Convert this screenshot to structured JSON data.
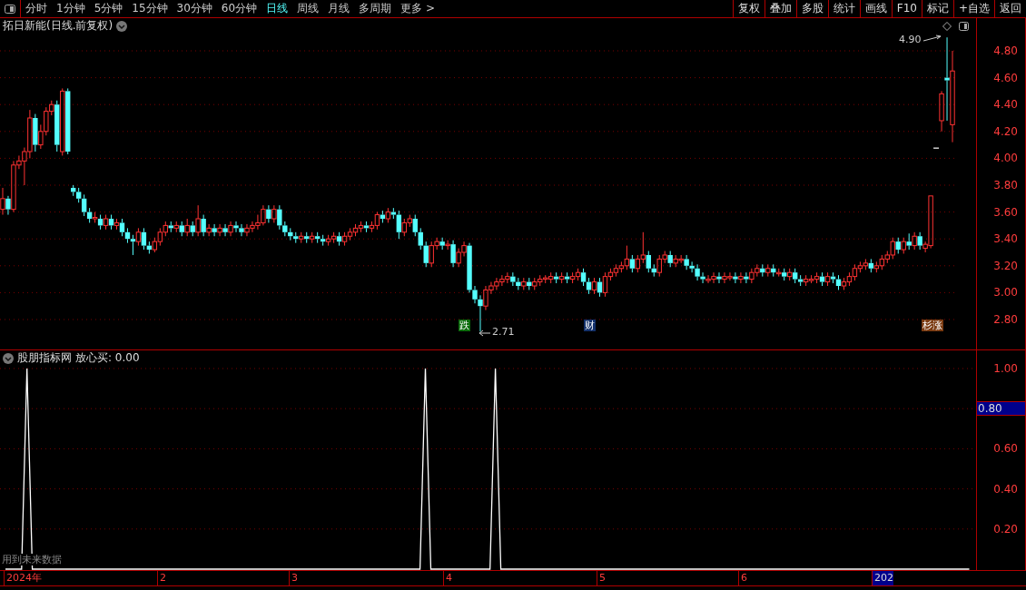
{
  "toolbar": {
    "tabs": [
      {
        "label": "分时",
        "selected": false
      },
      {
        "label": "1分钟",
        "selected": false
      },
      {
        "label": "5分钟",
        "selected": false
      },
      {
        "label": "15分钟",
        "selected": false
      },
      {
        "label": "30分钟",
        "selected": false
      },
      {
        "label": "60分钟",
        "selected": false
      },
      {
        "label": "日线",
        "selected": true
      },
      {
        "label": "周线",
        "selected": false
      },
      {
        "label": "月线",
        "selected": false
      },
      {
        "label": "多周期",
        "selected": false
      },
      {
        "label": "更多 >",
        "selected": false
      }
    ],
    "buttons": [
      "复权",
      "叠加",
      "多股",
      "统计",
      "画线",
      "F10",
      "标记",
      "+自选",
      "返回"
    ]
  },
  "price_chart": {
    "title": "拓日新能(日线.前复权)",
    "annotations": [
      {
        "text": "4.90"
      },
      {
        "text": "2.71"
      }
    ],
    "markers": [
      {
        "text": "跌",
        "color": "#0a6a0a"
      },
      {
        "text": "财",
        "color": "#12306a"
      },
      {
        "text": "杉涨",
        "color": "#7a3a10"
      }
    ],
    "chart_data": {
      "type": "candlestick",
      "ylim": [
        2.8,
        4.8
      ],
      "grid": true,
      "categories": [
        null,
        null,
        null,
        null,
        null,
        null,
        null,
        null,
        null,
        null,
        null,
        null,
        null,
        null,
        null,
        null,
        null,
        null,
        null,
        null,
        null,
        null,
        null,
        null,
        null,
        null,
        null,
        null,
        null,
        null,
        null,
        null,
        null,
        null,
        null,
        null,
        null,
        null,
        null,
        null,
        null,
        null,
        null,
        null,
        null,
        null,
        null,
        null,
        null,
        null,
        null,
        null,
        null,
        null,
        null,
        null,
        null,
        null,
        null,
        null,
        null,
        null,
        null,
        null,
        null,
        null,
        null,
        null,
        null,
        null,
        null,
        null,
        null,
        null,
        null,
        null,
        null,
        null,
        null,
        null,
        null,
        null,
        null,
        null,
        null,
        null,
        null,
        null,
        null,
        null,
        null,
        null,
        null,
        null,
        null,
        null,
        null,
        null,
        null,
        null,
        null,
        null,
        null,
        null,
        null,
        null,
        null,
        null,
        null,
        null,
        null,
        null,
        null,
        null,
        null,
        null,
        null,
        null,
        null,
        null,
        null,
        null,
        null,
        null,
        null,
        null,
        null,
        null,
        null,
        null,
        null,
        null,
        null,
        null,
        null,
        null,
        null,
        null,
        null,
        null,
        null,
        null,
        null,
        null,
        null,
        null,
        null,
        null,
        null,
        null,
        null,
        null,
        null,
        null,
        null,
        null,
        null,
        null,
        null,
        null,
        null,
        null,
        null,
        null,
        null,
        null,
        null,
        null,
        null,
        null,
        null,
        null,
        null,
        null,
        null,
        null
      ],
      "yticks": [
        {
          "value": 4.8,
          "label": "4.80"
        },
        {
          "value": 4.6,
          "label": "4.60"
        },
        {
          "value": 4.4,
          "label": "4.40"
        },
        {
          "value": 4.2,
          "label": "4.20"
        },
        {
          "value": 4.0,
          "label": "4.00"
        },
        {
          "value": 3.8,
          "label": "3.80"
        },
        {
          "value": 3.6,
          "label": "3.60"
        },
        {
          "value": 3.4,
          "label": "3.40"
        },
        {
          "value": 3.2,
          "label": "3.20"
        },
        {
          "value": 3.0,
          "label": "3.00"
        },
        {
          "value": 2.8,
          "label": "2.80"
        }
      ],
      "ohlc": [
        [
          3.62,
          3.78,
          3.58,
          3.7
        ],
        [
          3.7,
          3.72,
          3.58,
          3.62
        ],
        [
          3.62,
          3.98,
          3.6,
          3.95
        ],
        [
          3.95,
          4.02,
          3.92,
          3.98
        ],
        [
          3.98,
          4.08,
          3.8,
          4.05
        ],
        [
          4.05,
          4.36,
          4.0,
          4.3
        ],
        [
          4.3,
          4.33,
          4.05,
          4.1
        ],
        [
          4.1,
          4.25,
          4.07,
          4.2
        ],
        [
          4.2,
          4.38,
          4.17,
          4.35
        ],
        [
          4.35,
          4.43,
          4.32,
          4.4
        ],
        [
          4.4,
          4.43,
          4.05,
          4.1
        ],
        [
          4.05,
          4.52,
          4.02,
          4.5
        ],
        [
          4.5,
          4.52,
          4.03,
          4.05
        ],
        [
          3.78,
          3.8,
          3.72,
          3.75
        ],
        [
          3.75,
          3.78,
          3.67,
          3.7
        ],
        [
          3.7,
          3.73,
          3.57,
          3.6
        ],
        [
          3.6,
          3.63,
          3.52,
          3.55
        ],
        [
          3.55,
          3.6,
          3.52,
          3.56
        ],
        [
          3.55,
          3.58,
          3.47,
          3.5
        ],
        [
          3.5,
          3.58,
          3.47,
          3.55
        ],
        [
          3.55,
          3.58,
          3.47,
          3.5
        ],
        [
          3.5,
          3.55,
          3.47,
          3.52
        ],
        [
          3.52,
          3.55,
          3.42,
          3.45
        ],
        [
          3.45,
          3.48,
          3.37,
          3.4
        ],
        [
          3.4,
          3.43,
          3.28,
          3.38
        ],
        [
          3.38,
          3.48,
          3.35,
          3.45
        ],
        [
          3.45,
          3.48,
          3.32,
          3.35
        ],
        [
          3.35,
          3.38,
          3.29,
          3.32
        ],
        [
          3.32,
          3.41,
          3.3,
          3.38
        ],
        [
          3.38,
          3.48,
          3.35,
          3.45
        ],
        [
          3.45,
          3.53,
          3.42,
          3.5
        ],
        [
          3.5,
          3.53,
          3.45,
          3.48
        ],
        [
          3.48,
          3.53,
          3.45,
          3.5
        ],
        [
          3.5,
          3.53,
          3.42,
          3.45
        ],
        [
          3.45,
          3.55,
          3.42,
          3.5
        ],
        [
          3.5,
          3.53,
          3.42,
          3.45
        ],
        [
          3.45,
          3.65,
          3.42,
          3.55
        ],
        [
          3.55,
          3.58,
          3.42,
          3.45
        ],
        [
          3.45,
          3.51,
          3.42,
          3.48
        ],
        [
          3.48,
          3.51,
          3.42,
          3.45
        ],
        [
          3.45,
          3.51,
          3.42,
          3.48
        ],
        [
          3.48,
          3.51,
          3.42,
          3.45
        ],
        [
          3.45,
          3.53,
          3.42,
          3.5
        ],
        [
          3.5,
          3.53,
          3.45,
          3.48
        ],
        [
          3.48,
          3.51,
          3.42,
          3.45
        ],
        [
          3.45,
          3.51,
          3.42,
          3.48
        ],
        [
          3.48,
          3.53,
          3.45,
          3.5
        ],
        [
          3.5,
          3.58,
          3.47,
          3.52
        ],
        [
          3.52,
          3.65,
          3.5,
          3.62
        ],
        [
          3.62,
          3.65,
          3.52,
          3.55
        ],
        [
          3.55,
          3.65,
          3.52,
          3.62
        ],
        [
          3.62,
          3.65,
          3.47,
          3.5
        ],
        [
          3.5,
          3.53,
          3.42,
          3.45
        ],
        [
          3.45,
          3.48,
          3.39,
          3.42
        ],
        [
          3.42,
          3.45,
          3.37,
          3.4
        ],
        [
          3.4,
          3.45,
          3.37,
          3.42
        ],
        [
          3.42,
          3.45,
          3.37,
          3.4
        ],
        [
          3.4,
          3.45,
          3.37,
          3.42
        ],
        [
          3.42,
          3.45,
          3.37,
          3.4
        ],
        [
          3.4,
          3.43,
          3.35,
          3.38
        ],
        [
          3.38,
          3.43,
          3.35,
          3.4
        ],
        [
          3.4,
          3.45,
          3.37,
          3.42
        ],
        [
          3.42,
          3.45,
          3.35,
          3.38
        ],
        [
          3.38,
          3.45,
          3.35,
          3.42
        ],
        [
          3.42,
          3.48,
          3.39,
          3.45
        ],
        [
          3.45,
          3.51,
          3.42,
          3.48
        ],
        [
          3.48,
          3.53,
          3.45,
          3.5
        ],
        [
          3.5,
          3.53,
          3.45,
          3.48
        ],
        [
          3.48,
          3.53,
          3.45,
          3.5
        ],
        [
          3.5,
          3.6,
          3.47,
          3.58
        ],
        [
          3.58,
          3.61,
          3.52,
          3.55
        ],
        [
          3.55,
          3.63,
          3.52,
          3.6
        ],
        [
          3.6,
          3.63,
          3.55,
          3.58
        ],
        [
          3.58,
          3.61,
          3.4,
          3.45
        ],
        [
          3.45,
          3.55,
          3.42,
          3.52
        ],
        [
          3.52,
          3.58,
          3.49,
          3.55
        ],
        [
          3.55,
          3.58,
          3.42,
          3.45
        ],
        [
          3.45,
          3.48,
          3.32,
          3.35
        ],
        [
          3.35,
          3.38,
          3.19,
          3.22
        ],
        [
          3.22,
          3.38,
          3.19,
          3.35
        ],
        [
          3.35,
          3.41,
          3.32,
          3.38
        ],
        [
          3.38,
          3.41,
          3.32,
          3.35
        ],
        [
          3.35,
          3.39,
          3.32,
          3.36
        ],
        [
          3.36,
          3.39,
          3.19,
          3.22
        ],
        [
          3.22,
          3.33,
          3.19,
          3.3
        ],
        [
          3.3,
          3.38,
          3.27,
          3.35
        ],
        [
          3.35,
          3.37,
          3.0,
          3.02
        ],
        [
          3.02,
          3.05,
          2.92,
          2.95
        ],
        [
          2.95,
          2.98,
          2.71,
          2.9
        ],
        [
          2.9,
          3.05,
          2.87,
          3.02
        ],
        [
          3.02,
          3.08,
          2.99,
          3.05
        ],
        [
          3.05,
          3.11,
          3.02,
          3.08
        ],
        [
          3.08,
          3.13,
          3.05,
          3.1
        ],
        [
          3.1,
          3.15,
          3.07,
          3.12
        ],
        [
          3.12,
          3.15,
          3.05,
          3.08
        ],
        [
          3.08,
          3.11,
          3.02,
          3.05
        ],
        [
          3.05,
          3.11,
          3.02,
          3.08
        ],
        [
          3.08,
          3.11,
          3.02,
          3.05
        ],
        [
          3.05,
          3.11,
          3.02,
          3.08
        ],
        [
          3.08,
          3.13,
          3.05,
          3.1
        ],
        [
          3.1,
          3.13,
          3.07,
          3.11
        ],
        [
          3.1,
          3.15,
          3.07,
          3.12
        ],
        [
          3.12,
          3.15,
          3.07,
          3.1
        ],
        [
          3.1,
          3.15,
          3.07,
          3.12
        ],
        [
          3.12,
          3.15,
          3.07,
          3.1
        ],
        [
          3.1,
          3.15,
          3.07,
          3.12
        ],
        [
          3.12,
          3.18,
          3.09,
          3.15
        ],
        [
          3.15,
          3.18,
          3.05,
          3.08
        ],
        [
          3.08,
          3.11,
          2.99,
          3.02
        ],
        [
          3.02,
          3.11,
          2.99,
          3.08
        ],
        [
          3.08,
          3.11,
          2.97,
          3.0
        ],
        [
          3.0,
          3.15,
          2.97,
          3.12
        ],
        [
          3.12,
          3.18,
          3.09,
          3.15
        ],
        [
          3.15,
          3.21,
          3.12,
          3.18
        ],
        [
          3.18,
          3.23,
          3.15,
          3.2
        ],
        [
          3.2,
          3.35,
          3.17,
          3.25
        ],
        [
          3.25,
          3.28,
          3.15,
          3.18
        ],
        [
          3.18,
          3.28,
          3.15,
          3.25
        ],
        [
          3.25,
          3.45,
          3.22,
          3.28
        ],
        [
          3.28,
          3.31,
          3.15,
          3.18
        ],
        [
          3.18,
          3.21,
          3.12,
          3.15
        ],
        [
          3.15,
          3.28,
          3.12,
          3.25
        ],
        [
          3.25,
          3.31,
          3.22,
          3.28
        ],
        [
          3.28,
          3.31,
          3.19,
          3.22
        ],
        [
          3.22,
          3.28,
          3.19,
          3.25
        ],
        [
          3.24,
          3.28,
          3.22,
          3.25
        ],
        [
          3.25,
          3.28,
          3.17,
          3.2
        ],
        [
          3.2,
          3.23,
          3.15,
          3.18
        ],
        [
          3.18,
          3.21,
          3.09,
          3.12
        ],
        [
          3.12,
          3.15,
          3.07,
          3.1
        ],
        [
          3.09,
          3.13,
          3.07,
          3.1
        ],
        [
          3.1,
          3.15,
          3.07,
          3.12
        ],
        [
          3.12,
          3.15,
          3.07,
          3.1
        ],
        [
          3.1,
          3.15,
          3.07,
          3.12
        ],
        [
          3.11,
          3.15,
          3.09,
          3.12
        ],
        [
          3.12,
          3.15,
          3.07,
          3.1
        ],
        [
          3.1,
          3.15,
          3.07,
          3.12
        ],
        [
          3.12,
          3.15,
          3.07,
          3.1
        ],
        [
          3.1,
          3.18,
          3.07,
          3.15
        ],
        [
          3.15,
          3.21,
          3.12,
          3.18
        ],
        [
          3.18,
          3.21,
          3.12,
          3.15
        ],
        [
          3.15,
          3.21,
          3.12,
          3.18
        ],
        [
          3.18,
          3.21,
          3.12,
          3.15
        ],
        [
          3.14,
          3.18,
          3.12,
          3.15
        ],
        [
          3.15,
          3.18,
          3.09,
          3.12
        ],
        [
          3.12,
          3.18,
          3.09,
          3.15
        ],
        [
          3.15,
          3.18,
          3.07,
          3.1
        ],
        [
          3.1,
          3.13,
          3.05,
          3.08
        ],
        [
          3.08,
          3.13,
          3.05,
          3.1
        ],
        [
          3.09,
          3.13,
          3.07,
          3.1
        ],
        [
          3.1,
          3.15,
          3.07,
          3.12
        ],
        [
          3.12,
          3.15,
          3.05,
          3.08
        ],
        [
          3.08,
          3.15,
          3.05,
          3.12
        ],
        [
          3.12,
          3.15,
          3.07,
          3.1
        ],
        [
          3.1,
          3.13,
          3.02,
          3.05
        ],
        [
          3.05,
          3.11,
          3.02,
          3.08
        ],
        [
          3.08,
          3.15,
          3.05,
          3.12
        ],
        [
          3.12,
          3.21,
          3.09,
          3.18
        ],
        [
          3.18,
          3.23,
          3.15,
          3.2
        ],
        [
          3.2,
          3.25,
          3.17,
          3.22
        ],
        [
          3.22,
          3.25,
          3.15,
          3.18
        ],
        [
          3.18,
          3.23,
          3.15,
          3.2
        ],
        [
          3.2,
          3.28,
          3.17,
          3.25
        ],
        [
          3.25,
          3.31,
          3.22,
          3.28
        ],
        [
          3.28,
          3.41,
          3.25,
          3.38
        ],
        [
          3.38,
          3.41,
          3.29,
          3.32
        ],
        [
          3.32,
          3.41,
          3.29,
          3.38
        ],
        [
          3.38,
          3.44,
          3.32,
          3.35
        ],
        [
          3.35,
          3.45,
          3.32,
          3.42
        ],
        [
          3.42,
          3.45,
          3.32,
          3.35
        ],
        [
          3.33,
          3.38,
          3.3,
          3.36
        ],
        [
          3.35,
          3.72,
          3.33,
          3.72
        ],
        [
          4.08,
          4.08,
          4.08,
          4.08
        ],
        [
          4.28,
          4.5,
          4.2,
          4.48
        ],
        [
          4.6,
          4.9,
          4.28,
          4.58
        ],
        [
          4.25,
          4.8,
          4.12,
          4.65
        ]
      ]
    }
  },
  "indicator": {
    "title": "股朋指标网",
    "value_text": ": 0.00",
    "cursor_value": "0.80",
    "note": "用到未来数据",
    "chart_data": {
      "type": "line",
      "ylim": [
        0,
        1
      ],
      "grid": true,
      "yticks": [
        {
          "value": 1,
          "label": "1.00"
        },
        {
          "value": 0.6,
          "label": "0.60"
        },
        {
          "value": 0.4,
          "label": "0.40"
        },
        {
          "value": 0.2,
          "label": "0.20"
        }
      ],
      "series": [
        {
          "name": "放心买",
          "color": "#ffffff",
          "values": [
            0,
            0,
            0,
            0,
            1,
            0,
            0,
            0,
            0,
            0,
            0,
            0,
            0,
            0,
            0,
            0,
            0,
            0,
            0,
            0,
            0,
            0,
            0,
            0,
            0,
            0,
            0,
            0,
            0,
            0,
            0,
            0,
            0,
            0,
            0,
            0,
            0,
            0,
            0,
            0,
            0,
            0,
            0,
            0,
            0,
            0,
            0,
            0,
            0,
            0,
            0,
            0,
            0,
            0,
            0,
            0,
            0,
            0,
            0,
            0,
            0,
            0,
            0,
            0,
            0,
            0,
            0,
            0,
            0,
            0,
            0,
            0,
            0,
            0,
            0,
            0,
            0,
            0,
            1,
            0,
            0,
            0,
            0,
            0,
            0,
            0,
            0,
            0,
            0,
            0,
            0,
            1,
            0,
            0,
            0,
            0,
            0,
            0,
            0,
            0,
            0,
            0,
            0,
            0,
            0,
            0,
            0,
            0,
            0,
            0,
            0,
            0,
            0,
            0,
            0,
            0,
            0,
            0,
            0,
            0,
            0,
            0,
            0,
            0,
            0,
            0,
            0,
            0,
            0,
            0,
            0,
            0,
            0,
            0,
            0,
            0,
            0,
            0,
            0,
            0,
            0,
            0,
            0,
            0,
            0,
            0,
            0,
            0,
            0,
            0,
            0,
            0,
            0,
            0,
            0,
            0,
            0,
            0,
            0,
            0,
            0,
            0,
            0,
            0,
            0,
            0,
            0,
            0,
            0,
            0,
            0,
            0,
            0,
            0,
            0,
            0,
            0,
            0,
            0,
            0
          ]
        }
      ]
    }
  },
  "date_axis": [
    "2024年",
    "2",
    "3",
    "4",
    "5",
    "6",
    "202"
  ]
}
